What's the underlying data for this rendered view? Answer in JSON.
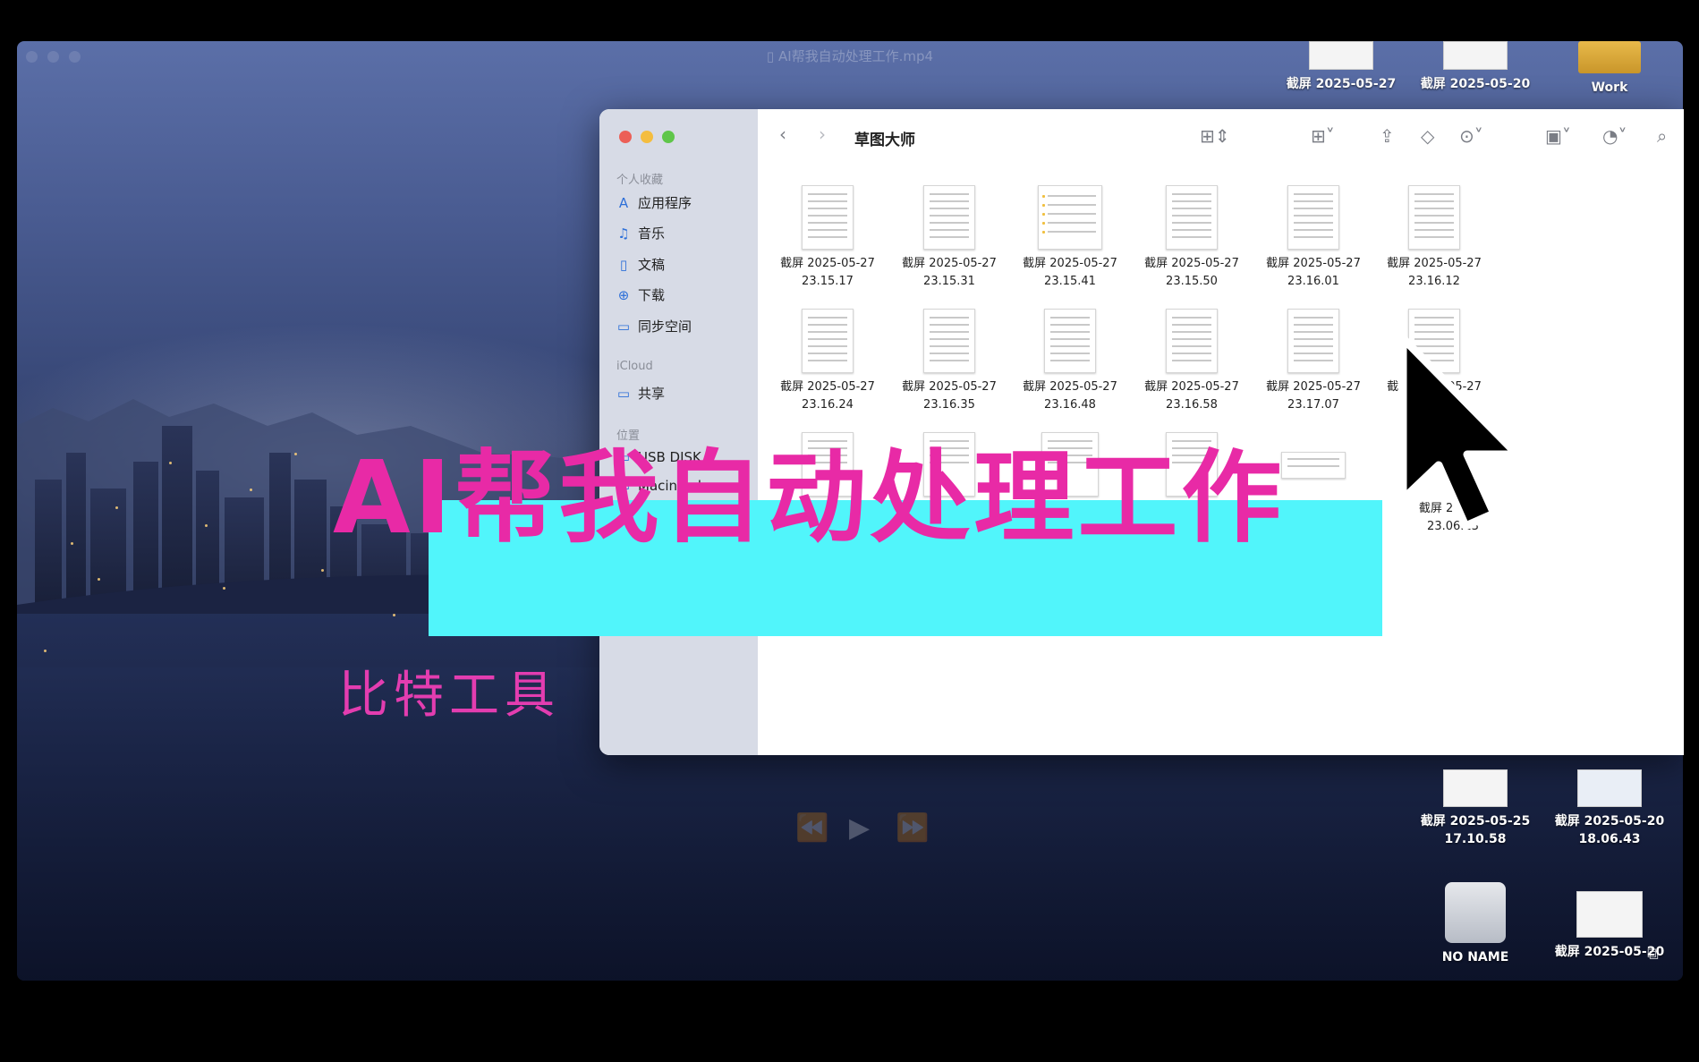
{
  "player": {
    "title": "AI帮我自动处理工作.mp4"
  },
  "finder": {
    "title": "草图大师",
    "sidebar": {
      "sections": [
        {
          "header": "个人收藏",
          "items": [
            {
              "label": "应用程序",
              "icon": "apps-icon"
            },
            {
              "label": "音乐",
              "icon": "music-icon"
            },
            {
              "label": "文稿",
              "icon": "document-icon"
            },
            {
              "label": "下载",
              "icon": "download-icon"
            },
            {
              "label": "同步空间",
              "icon": "folder-icon"
            }
          ]
        },
        {
          "header": "iCloud",
          "items": [
            {
              "label": "共享",
              "icon": "shared-folder-icon"
            }
          ]
        },
        {
          "header": "位置",
          "items": [
            {
              "label": "USB DISK",
              "icon": "disk-icon"
            },
            {
              "label": "Macintosh",
              "icon": "disk-icon"
            }
          ]
        }
      ]
    },
    "files": [
      {
        "name": "截屏 2025-05-27",
        "time": "23.15.17"
      },
      {
        "name": "截屏 2025-05-27",
        "time": "23.15.31"
      },
      {
        "name": "截屏 2025-05-27",
        "time": "23.15.41"
      },
      {
        "name": "截屏 2025-05-27",
        "time": "23.15.50"
      },
      {
        "name": "截屏 2025-05-27",
        "time": "23.16.01"
      },
      {
        "name": "截屏 2025-05-27",
        "time": "23.16.12"
      },
      {
        "name": "截屏 2025-05-27",
        "time": "23.16.24"
      },
      {
        "name": "截屏 2025-05-27",
        "time": "23.16.35"
      },
      {
        "name": "截屏 2025-05-27",
        "time": "23.16.48"
      },
      {
        "name": "截屏 2025-05-27",
        "time": "23.16.58"
      },
      {
        "name": "截屏 2025-05-27",
        "time": "23.17.07"
      },
      {
        "name": "截屏 2025-05-27",
        "time": ""
      },
      {
        "name": "",
        "time": ""
      },
      {
        "name": "",
        "time": ""
      },
      {
        "name": "",
        "time": ""
      },
      {
        "name": "",
        "time": ""
      },
      {
        "name": "",
        "time": ""
      },
      {
        "name": "截屏 2025-0",
        "time": "23.06.13"
      }
    ]
  },
  "desktop_icons": [
    {
      "name": "截屏 2025-05-27",
      "time": ""
    },
    {
      "name": "截屏 2025-05-20",
      "time": ""
    },
    {
      "name": "Work",
      "time": ""
    },
    {
      "name": "截屏 2025-05-25",
      "time": "17.10.58"
    },
    {
      "name": "截屏 2025-05-20",
      "time": "18.06.43"
    },
    {
      "name": "NO NAME",
      "time": ""
    },
    {
      "name": "截屏 2025-05-20",
      "time": ""
    }
  ],
  "overlay": {
    "title": "AI帮我自动处理工作",
    "subtitle": "比特工具",
    "title_color": "#e82aa6",
    "band_color": "#51f5fb"
  }
}
